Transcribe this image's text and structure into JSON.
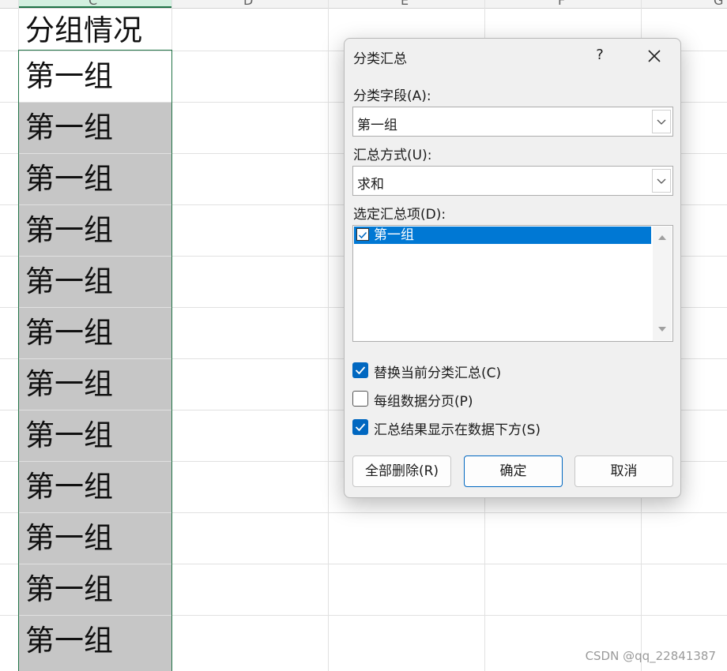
{
  "sheet": {
    "column_letters": [
      "C",
      "D",
      "E",
      "F",
      "G"
    ],
    "header_cell": "分组情况",
    "cells": [
      "第一组",
      "第一组",
      "第一组",
      "第一组",
      "第一组",
      "第一组",
      "第一组",
      "第一组",
      "第一组",
      "第一组",
      "第一组",
      "第一组"
    ]
  },
  "dialog": {
    "title": "分类汇总",
    "help": "?",
    "field_label": "分类字段(A):",
    "field_value": "第一组",
    "method_label": "汇总方式(U):",
    "method_value": "求和",
    "items_label": "选定汇总项(D):",
    "items": [
      {
        "label": "第一组",
        "checked": true
      }
    ],
    "options": [
      {
        "label": "替换当前分类汇总(C)",
        "checked": true
      },
      {
        "label": "每组数据分页(P)",
        "checked": false
      },
      {
        "label": "汇总结果显示在数据下方(S)",
        "checked": true
      }
    ],
    "buttons": {
      "remove_all": "全部删除(R)",
      "ok": "确定",
      "cancel": "取消"
    }
  },
  "watermark": "CSDN @qq_22841387",
  "colors": {
    "accent": "#0067c0",
    "selection": "#0078d4",
    "cell_shade": "#c6c6c6",
    "grid_selection": "#217346"
  }
}
